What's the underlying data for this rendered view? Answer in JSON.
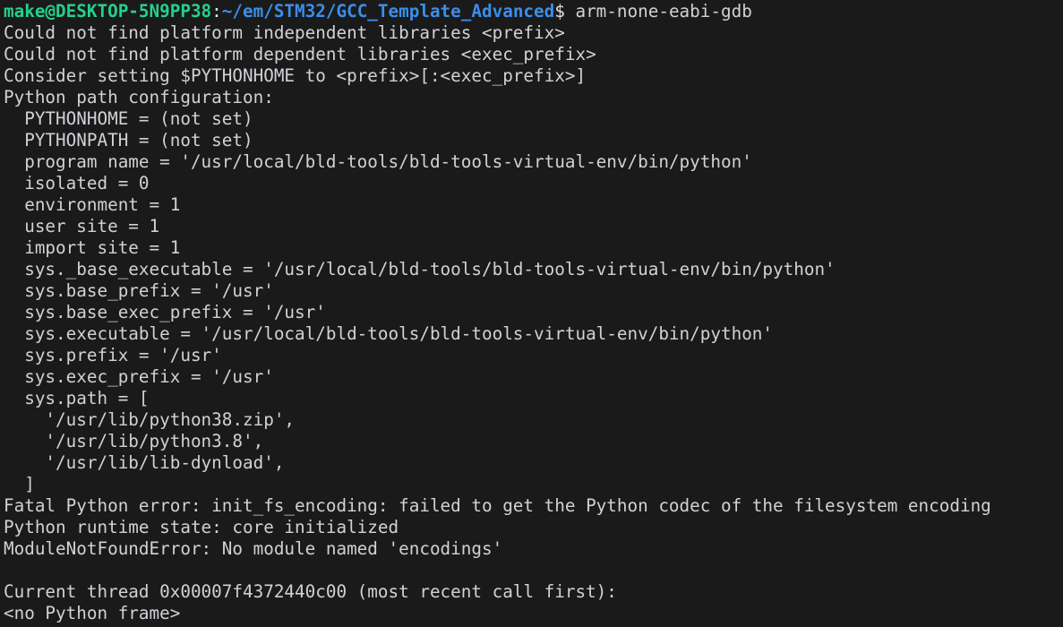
{
  "terminal": {
    "background_color": "#1a1a1a",
    "foreground_color": "#cfd2d6",
    "prompt": {
      "user_host": "make@DESKTOP-5N9PP38",
      "user_host_color": "#23d18b",
      "separator": ":",
      "path": "~/em/STM32/GCC_Template_Advanced",
      "path_color": "#3b8eea",
      "symbol": "$",
      "command": " arm-none-eabi-gdb"
    },
    "output_lines": [
      "Could not find platform independent libraries <prefix>",
      "Could not find platform dependent libraries <exec_prefix>",
      "Consider setting $PYTHONHOME to <prefix>[:<exec_prefix>]",
      "Python path configuration:",
      "  PYTHONHOME = (not set)",
      "  PYTHONPATH = (not set)",
      "  program name = '/usr/local/bld-tools/bld-tools-virtual-env/bin/python'",
      "  isolated = 0",
      "  environment = 1",
      "  user site = 1",
      "  import site = 1",
      "  sys._base_executable = '/usr/local/bld-tools/bld-tools-virtual-env/bin/python'",
      "  sys.base_prefix = '/usr'",
      "  sys.base_exec_prefix = '/usr'",
      "  sys.executable = '/usr/local/bld-tools/bld-tools-virtual-env/bin/python'",
      "  sys.prefix = '/usr'",
      "  sys.exec_prefix = '/usr'",
      "  sys.path = [",
      "    '/usr/lib/python38.zip',",
      "    '/usr/lib/python3.8',",
      "    '/usr/lib/lib-dynload',",
      "  ]",
      "Fatal Python error: init_fs_encoding: failed to get the Python codec of the filesystem encoding",
      "Python runtime state: core initialized",
      "ModuleNotFoundError: No module named 'encodings'",
      "",
      "Current thread 0x00007f4372440c00 (most recent call first):",
      "<no Python frame>"
    ]
  }
}
